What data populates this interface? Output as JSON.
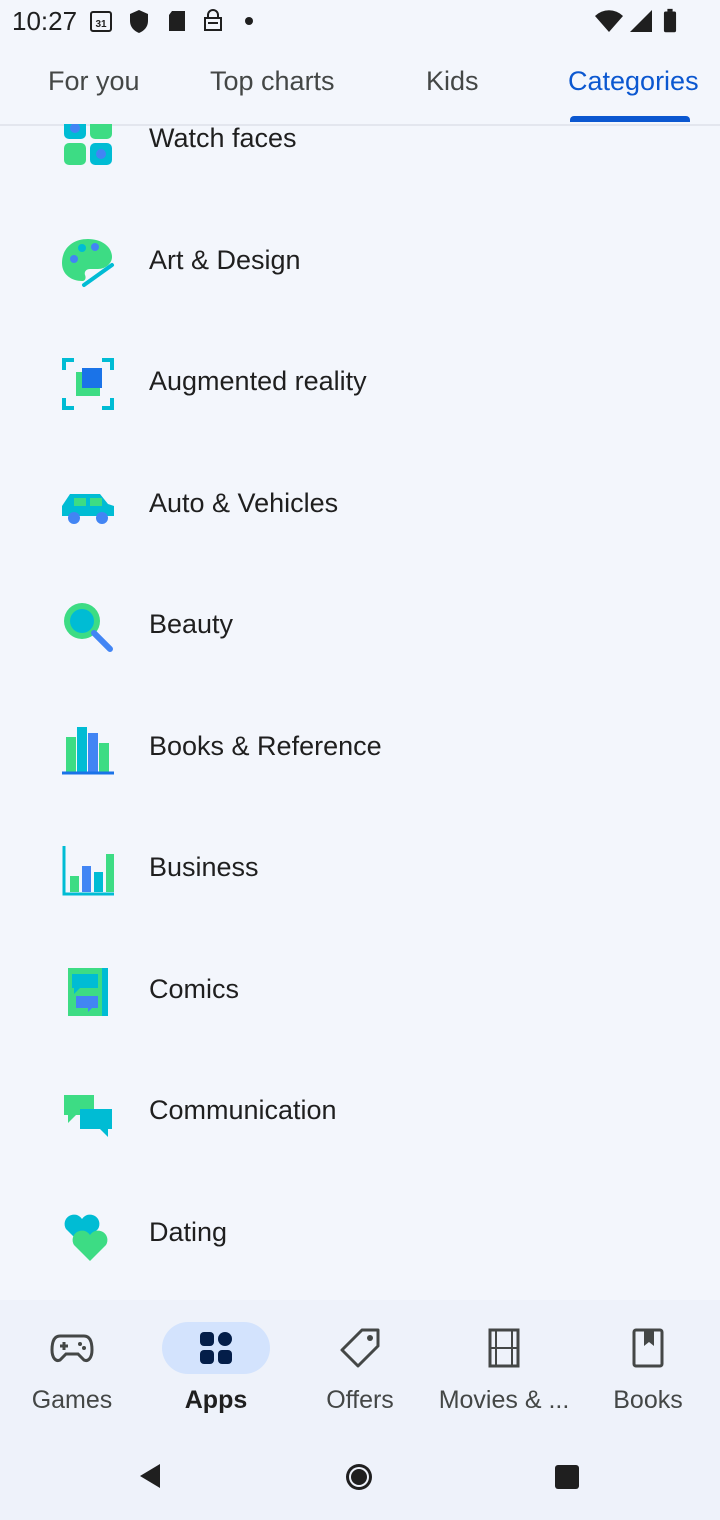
{
  "status_bar": {
    "time": "10:27",
    "icons": [
      "calendar-icon",
      "shield-icon",
      "sd-card-icon",
      "store-icon",
      "dot-icon",
      "wifi-icon",
      "signal-icon",
      "battery-icon"
    ],
    "calendar_day": "31"
  },
  "tabs": [
    {
      "label": "For you",
      "active": false
    },
    {
      "label": "Top charts",
      "active": false
    },
    {
      "label": "Kids",
      "active": false
    },
    {
      "label": "Categories",
      "active": true
    }
  ],
  "categories": [
    {
      "label": "Watch faces",
      "icon": "watch-faces-icon"
    },
    {
      "label": "Art & Design",
      "icon": "art-design-icon"
    },
    {
      "label": "Augmented reality",
      "icon": "augmented-reality-icon"
    },
    {
      "label": "Auto & Vehicles",
      "icon": "car-icon"
    },
    {
      "label": "Beauty",
      "icon": "mirror-icon"
    },
    {
      "label": "Books & Reference",
      "icon": "books-icon"
    },
    {
      "label": "Business",
      "icon": "bar-chart-icon"
    },
    {
      "label": "Comics",
      "icon": "comics-icon"
    },
    {
      "label": "Communication",
      "icon": "chat-bubbles-icon"
    },
    {
      "label": "Dating",
      "icon": "hearts-icon"
    }
  ],
  "bottom_nav": [
    {
      "label": "Games",
      "icon": "gamepad-icon",
      "active": false
    },
    {
      "label": "Apps",
      "icon": "apps-grid-icon",
      "active": true
    },
    {
      "label": "Offers",
      "icon": "tag-icon",
      "active": false
    },
    {
      "label": "Movies & ...",
      "icon": "film-icon",
      "active": false
    },
    {
      "label": "Books",
      "icon": "bookmark-book-icon",
      "active": false
    }
  ],
  "system_nav": [
    "back-icon",
    "home-icon",
    "recents-icon"
  ],
  "colors": {
    "accent": "#0b57d0",
    "background": "#f3f6fc",
    "nav_background": "#eef2fa",
    "active_pill": "#d3e3fd",
    "icon_green": "#3ddc84",
    "icon_blue": "#4285f4",
    "icon_teal": "#00bcd4"
  }
}
